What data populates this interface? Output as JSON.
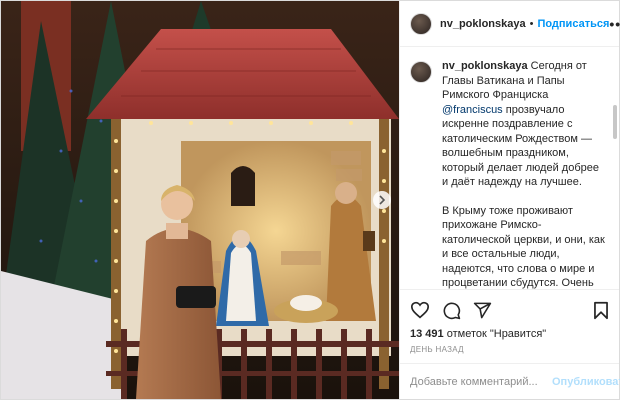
{
  "post": {
    "username": "nv_poklonskaya",
    "separator": "•",
    "follow_label": "Подписаться",
    "more_label": "•••",
    "caption": {
      "username": "nv_poklonskaya",
      "text1_before": " Сегодня от Главы Ватикана и Папы Римского Франциска ",
      "mention": "@franciscus",
      "text1_after": " прозвучало искренне поздравление с католическим Рождеством — волшебным праздником, который делает людей добрее и даёт надежду на лучшее.",
      "text2": "В Крыму тоже проживают прихожане Римско-католической церкви, и они, как и все остальные люди, надеются, что слова о мире и процветании сбудутся. Очень рассчитываем на молитву Понтифика о восстановлении их нарушенных прав — в том числе и права на питьевую воду, перекрытую властями Украины в отместку за проведённый"
    },
    "icons": {
      "like": "heart-icon",
      "comment": "comment-icon",
      "share": "share-icon",
      "save": "bookmark-icon",
      "next": "chevron-right-icon"
    },
    "likes_count": "13 491",
    "likes_text": " отметок \"Нравится\"",
    "timestamp": "ДЕНЬ НАЗАД",
    "comment_placeholder": "Добавьте комментарий...",
    "publish_label": "Опубликовать",
    "colors": {
      "link_blue": "#0095f6",
      "mention": "#00376b",
      "publish_disabled": "#b2dffc",
      "muted": "#8e8e8e"
    }
  }
}
